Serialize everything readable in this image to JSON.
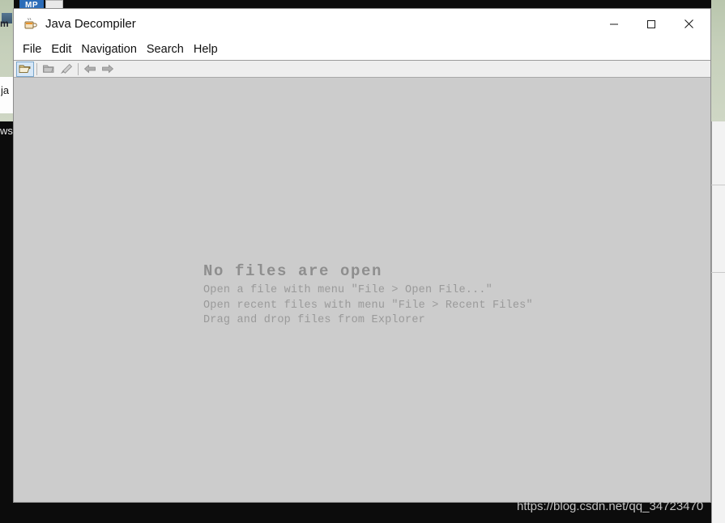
{
  "window": {
    "title": "Java Decompiler",
    "icon": "java-coffee-cup-icon",
    "controls": {
      "minimize_label": "—",
      "maximize_label": "□",
      "close_label": "✕"
    }
  },
  "menu": {
    "items": [
      {
        "label": "File"
      },
      {
        "label": "Edit"
      },
      {
        "label": "Navigation"
      },
      {
        "label": "Search"
      },
      {
        "label": "Help"
      }
    ]
  },
  "toolbar": {
    "buttons": [
      {
        "name": "open-file-button",
        "icon": "open-folder-icon",
        "enabled": true,
        "active": true
      },
      {
        "name": "open-type-button",
        "icon": "closed-folder-icon",
        "enabled": false,
        "active": false
      },
      {
        "name": "clear-button",
        "icon": "eraser-icon",
        "enabled": false,
        "active": false
      },
      {
        "name": "navigate-back-button",
        "icon": "arrow-left-icon",
        "enabled": false,
        "active": false
      },
      {
        "name": "navigate-forward-button",
        "icon": "arrow-right-icon",
        "enabled": false,
        "active": false
      }
    ]
  },
  "editor": {
    "empty_state": {
      "title": "No files are open",
      "lines": [
        "Open a file with menu ʺFile > Open File...ʺ",
        "Open recent files with menu ʺFile > Recent Filesʺ",
        "Drag and drop files from Explorer"
      ]
    }
  },
  "watermark": {
    "text": "https://blog.csdn.net/qq_34723470"
  },
  "desktop": {
    "fragments": {
      "left_white": "ja",
      "left_dark": "ws",
      "top_left": "m"
    },
    "taskbar_icon_label": "MP"
  },
  "colors": {
    "window_chrome": "#ffffff",
    "toolbar_bg": "#eeeeee",
    "editor_bg": "#cccccc",
    "empty_text": "#9a9a9a",
    "accent_highlight": "#d6e7f7",
    "desktop_black": "#0c0c0c",
    "wallpaper_green": "#c6d0bb"
  }
}
